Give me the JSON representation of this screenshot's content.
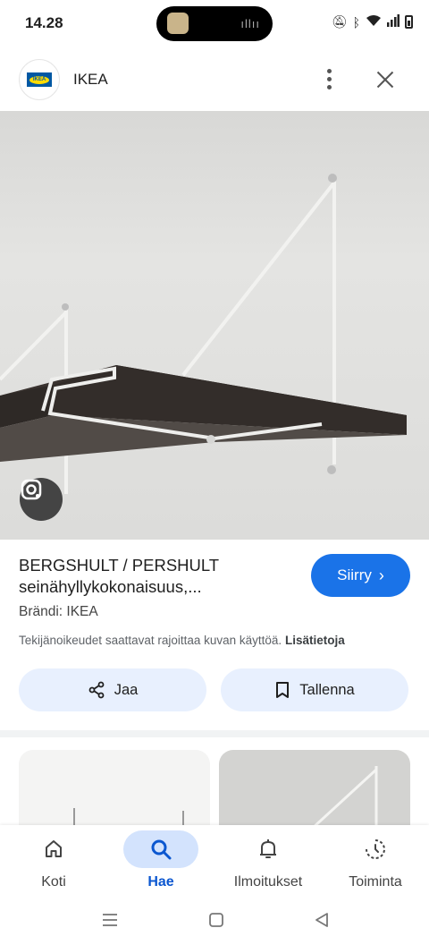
{
  "status_bar": {
    "time": "14.28",
    "icons": [
      "mute-icon",
      "bluetooth-icon",
      "wifi-icon",
      "signal-icon",
      "battery-icon"
    ]
  },
  "app_bar": {
    "title": "IKEA",
    "logo_text": "IKEA"
  },
  "result": {
    "title_line1": "BERGSHULT / PERSHULT",
    "title_line2": "seinähyllykokonaisuus,...",
    "go_button": "Siirry",
    "brand": "Brändi: IKEA",
    "copyright": "Tekijänoikeudet saattavat rajoittaa kuvan käyttöä.",
    "more_info": "Lisätietoja"
  },
  "actions": {
    "share": "Jaa",
    "save": "Tallenna"
  },
  "bottom_nav": {
    "items": [
      {
        "label": "Koti",
        "icon": "home-icon"
      },
      {
        "label": "Hae",
        "icon": "search-icon"
      },
      {
        "label": "Ilmoitukset",
        "icon": "bell-icon"
      },
      {
        "label": "Toiminta",
        "icon": "activity-icon"
      }
    ],
    "active": "Hae"
  },
  "colors": {
    "accent": "#1a73e8",
    "pill_bg": "#e8f0fe",
    "active_nav_bg": "#d3e3fd",
    "active_nav_text": "#0b57d0"
  }
}
